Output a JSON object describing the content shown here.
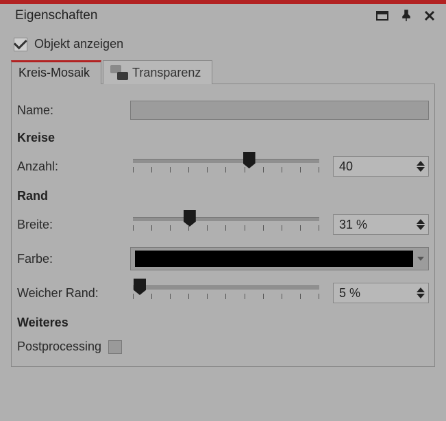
{
  "title": "Eigenschaften",
  "showObject": {
    "label": "Objekt anzeigen",
    "checked": true
  },
  "tabs": [
    {
      "label": "Kreis-Mosaik",
      "active": true
    },
    {
      "label": "Transparenz",
      "active": false
    }
  ],
  "fields": {
    "name": {
      "label": "Name:",
      "value": ""
    }
  },
  "sections": {
    "circles": "Kreise",
    "border": "Rand",
    "more": "Weiteres"
  },
  "count": {
    "label": "Anzahl:",
    "value": "40",
    "pos": 62
  },
  "width": {
    "label": "Breite:",
    "value": "31 %",
    "pos": 31
  },
  "color": {
    "label": "Farbe:",
    "value": "#000000"
  },
  "soft": {
    "label": "Weicher Rand:",
    "value": "5 %",
    "pos": 5
  },
  "post": {
    "label": "Postprocessing",
    "checked": false
  }
}
